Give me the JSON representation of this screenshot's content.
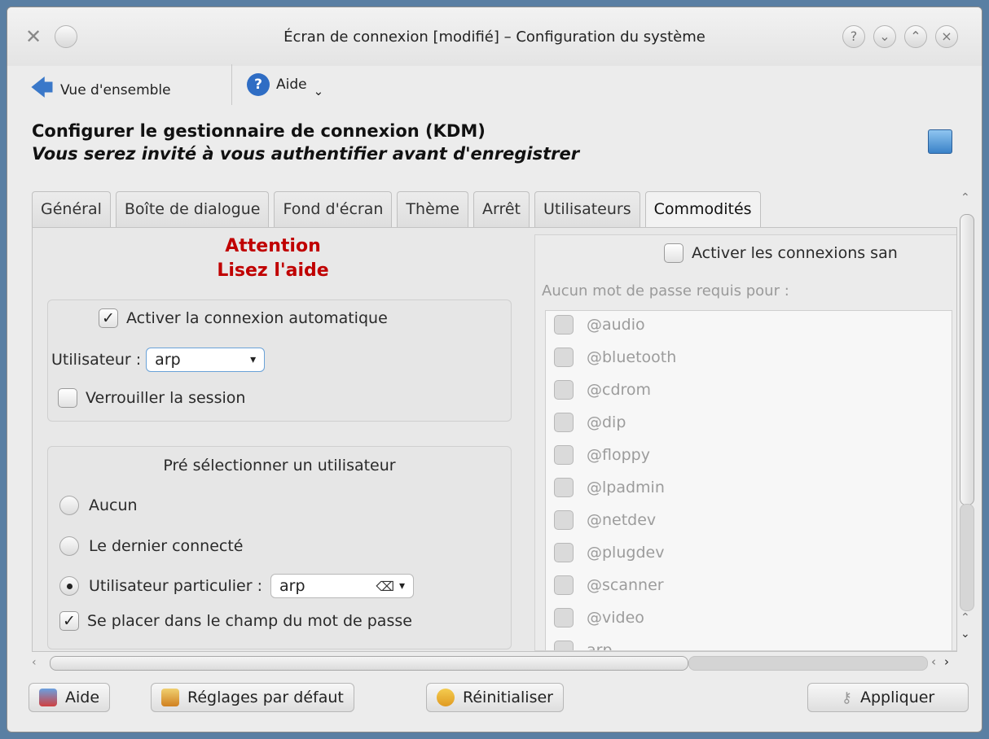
{
  "window": {
    "title": "Écran de connexion [modifié] – Configuration du système",
    "controls": [
      "help-icon",
      "minimize-icon",
      "maximize-icon",
      "close-icon"
    ]
  },
  "toolbar": {
    "overview_label": "Vue d'ensemble",
    "help_label": "Aide"
  },
  "header": {
    "title": "Configurer le gestionnaire de connexion (KDM)",
    "subtitle": "Vous serez invité à vous authentifier avant d'enregistrer"
  },
  "tabs": [
    {
      "label": "Général"
    },
    {
      "label": "Boîte de dialogue"
    },
    {
      "label": "Fond d'écran"
    },
    {
      "label": "Thème"
    },
    {
      "label": "Arrêt"
    },
    {
      "label": "Utilisateurs"
    },
    {
      "label": "Commodités",
      "active": true
    }
  ],
  "left": {
    "warning_line1": "Attention",
    "warning_line2": "Lisez l'aide",
    "autologin_label": "Activer la connexion automatique",
    "autologin_checked": true,
    "user_label": "Utilisateur :",
    "user_value": "arp",
    "lock_label": "Verrouiller la session",
    "lock_checked": false,
    "preselect_title": "Pré sélectionner un utilisateur",
    "radio_none": "Aucun",
    "radio_last": "Le dernier connecté",
    "radio_specific": "Utilisateur particulier :",
    "specific_value": "arp",
    "specific_selected": true,
    "focus_password_label": "Se placer dans le champ du mot de passe",
    "focus_password_checked": true
  },
  "right": {
    "nopass_enable_label": "Activer les connexions san",
    "nopass_required_label": "Aucun mot de passe requis pour :",
    "groups": [
      "@audio",
      "@bluetooth",
      "@cdrom",
      "@dip",
      "@floppy",
      "@lpadmin",
      "@netdev",
      "@plugdev",
      "@scanner",
      "@video",
      "arp"
    ]
  },
  "buttons": {
    "help": "Aide",
    "defaults": "Réglages par défaut",
    "reset": "Réinitialiser",
    "apply": "Appliquer"
  }
}
